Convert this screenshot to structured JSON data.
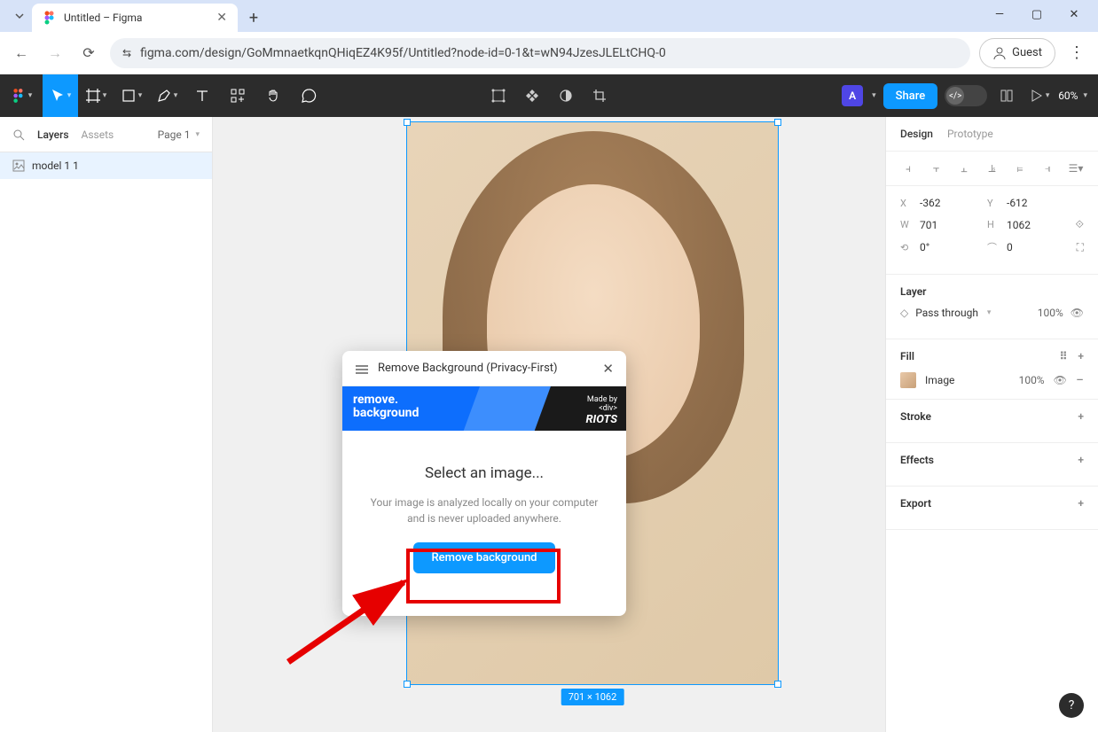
{
  "browser": {
    "tab_title": "Untitled – Figma",
    "url": "figma.com/design/GoMmnaetkqnQHiqEZ4K95f/Untitled?node-id=0-1&t=wN94JzesJLELtCHQ-0",
    "guest_label": "Guest"
  },
  "toolbar": {
    "share_label": "Share",
    "zoom": "60%"
  },
  "left_panel": {
    "tabs": {
      "layers": "Layers",
      "assets": "Assets"
    },
    "page": "Page 1",
    "layer_name": "model 1 1"
  },
  "canvas": {
    "dimensions_badge": "701 × 1062"
  },
  "plugin": {
    "title": "Remove Background (Privacy-First)",
    "banner_line1": "remove.",
    "banner_line2": "background",
    "banner_madeby": "Made by",
    "banner_div": "<div>",
    "banner_riots": "RIOTS",
    "heading": "Select an image...",
    "description": "Your image is analyzed locally on your computer and is never uploaded anywhere.",
    "button": "Remove background"
  },
  "right_panel": {
    "tabs": {
      "design": "Design",
      "prototype": "Prototype"
    },
    "position": {
      "x": "-362",
      "y": "-612",
      "w": "701",
      "h": "1062",
      "rotation": "0°",
      "radius": "0"
    },
    "layer_heading": "Layer",
    "blend_mode": "Pass through",
    "blend_opacity": "100%",
    "fill_heading": "Fill",
    "fill_label": "Image",
    "fill_opacity": "100%",
    "stroke_heading": "Stroke",
    "effects_heading": "Effects",
    "export_heading": "Export"
  }
}
